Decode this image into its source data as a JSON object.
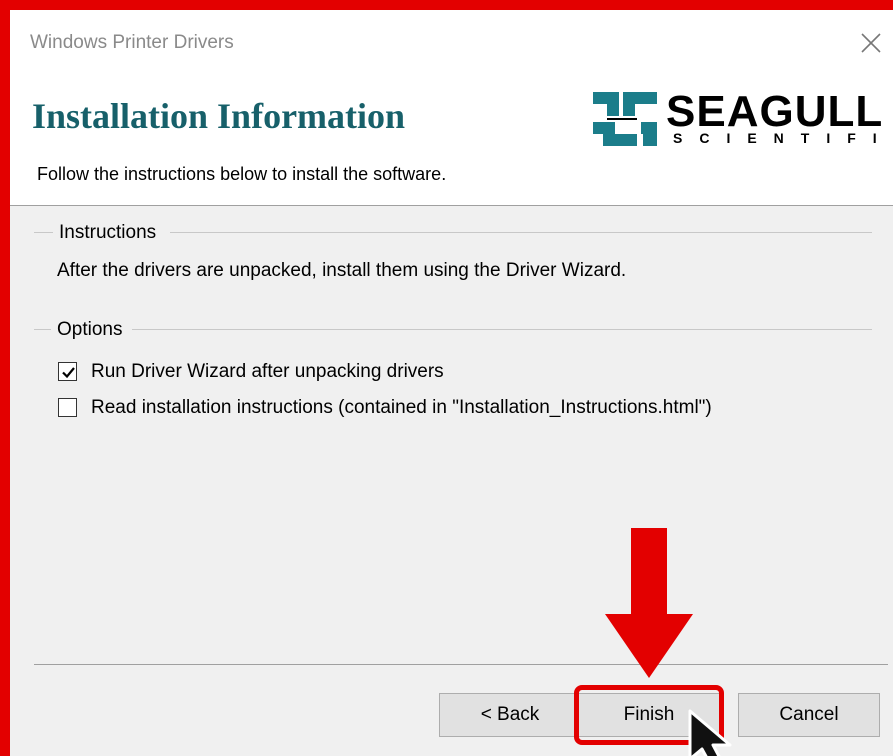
{
  "window": {
    "title": "Windows Printer Drivers",
    "close_icon": "close-icon"
  },
  "header": {
    "heading": "Installation Information",
    "subheading": "Follow the instructions below to install the software.",
    "logo": {
      "name": "SEAGULL",
      "sub": "SCIENTIFIC"
    }
  },
  "instructions": {
    "label": "Instructions",
    "text": "After the drivers are unpacked, install them using the Driver Wizard."
  },
  "options": {
    "label": "Options",
    "items": [
      {
        "label": "Run Driver Wizard after unpacking drivers",
        "checked": true
      },
      {
        "label": "Read installation instructions (contained in \"Installation_Instructions.html\")",
        "checked": false
      }
    ]
  },
  "buttons": {
    "back": "< Back",
    "finish": "Finish",
    "cancel": "Cancel"
  },
  "annotation": {
    "highlight_color": "#e30000",
    "arrow_icon": "down-arrow-icon",
    "cursor_icon": "mouse-pointer-icon"
  }
}
